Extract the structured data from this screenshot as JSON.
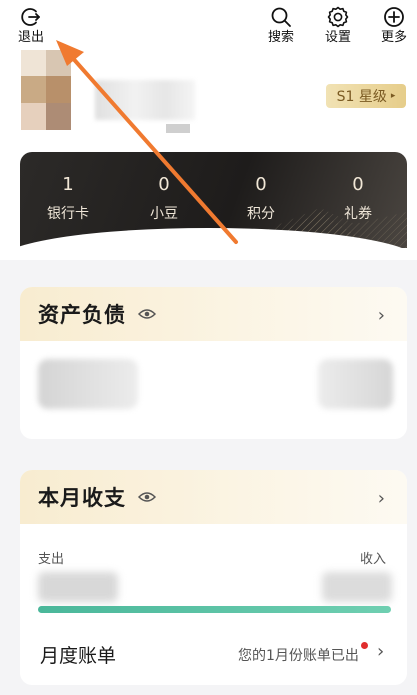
{
  "toolbar": {
    "logout_label": "退出",
    "search_label": "搜索",
    "settings_label": "设置",
    "more_label": "更多"
  },
  "profile": {
    "level_badge": "S1 星级",
    "level_badge_arrow": "▸"
  },
  "stats": [
    {
      "value": "1",
      "label": "银行卡"
    },
    {
      "value": "0",
      "label": "小豆"
    },
    {
      "value": "0",
      "label": "积分"
    },
    {
      "value": "0",
      "label": "礼券"
    }
  ],
  "assets": {
    "title": "资产负债",
    "chevron": "›"
  },
  "monthly": {
    "title": "本月收支",
    "chevron": "›",
    "expense_label": "支出",
    "income_label": "收入"
  },
  "bill": {
    "label": "月度账单",
    "note": "您的1月份账单已出",
    "chevron": "›"
  },
  "colors": {
    "accent_green": "#4ab79a",
    "badge_gold": "#e6cd8a",
    "arrow_orange": "#f07a30",
    "notice_red": "#e02d2d"
  }
}
